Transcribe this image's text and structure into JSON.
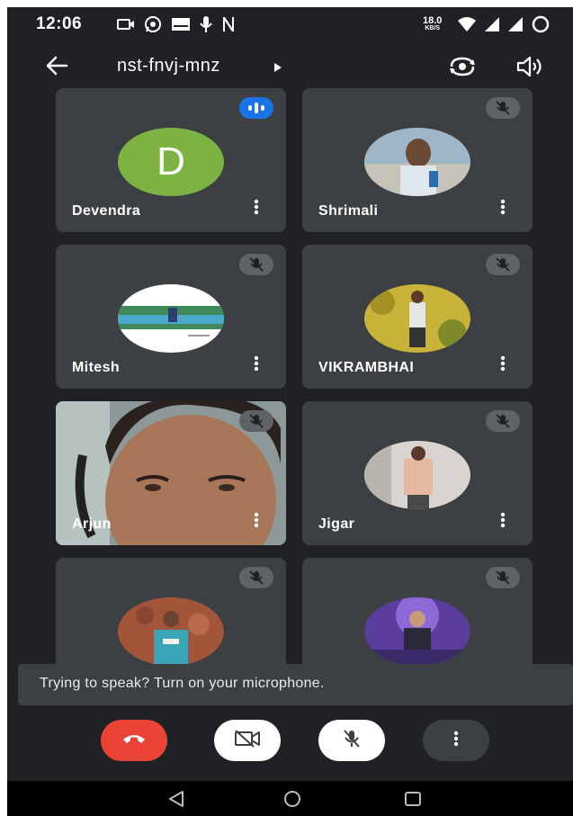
{
  "status_bar": {
    "time": "12:06",
    "network_speed": "18.0",
    "network_unit": "KB/S",
    "icons": [
      "cast-icon",
      "whatsapp-icon",
      "app-icon",
      "mic-icon",
      "notification-n-icon",
      "wifi-icon",
      "signal-icon",
      "signal-icon",
      "battery-icon"
    ]
  },
  "top_bar": {
    "meeting_code": "nst-fnvj-mnz",
    "back_icon": "arrow-left-icon",
    "flip_icon": "camera-flip-icon",
    "speaker_icon": "speaker-icon"
  },
  "participants": [
    {
      "name": "Devendra",
      "avatar_letter": "D",
      "status": "speaking"
    },
    {
      "name": "Shrimali",
      "status": "muted"
    },
    {
      "name": "Mitesh",
      "status": "muted"
    },
    {
      "name": "VIKRAMBHAI",
      "status": "muted"
    },
    {
      "name": "Arjun",
      "status": "muted",
      "video": true
    },
    {
      "name": "Jigar",
      "status": "muted"
    },
    {
      "name": "",
      "status": "muted"
    },
    {
      "name": "",
      "status": "muted"
    }
  ],
  "toast": {
    "message": "Trying to speak? Turn on your microphone."
  },
  "controls": {
    "end_call_color": "#ea4335",
    "toggle_color": "#ffffff",
    "more_color": "#3c4043"
  },
  "colors": {
    "background": "#202124",
    "tile": "#3c4043",
    "speaking_badge": "#1a73e8",
    "avatar_green": "#7cb342"
  }
}
